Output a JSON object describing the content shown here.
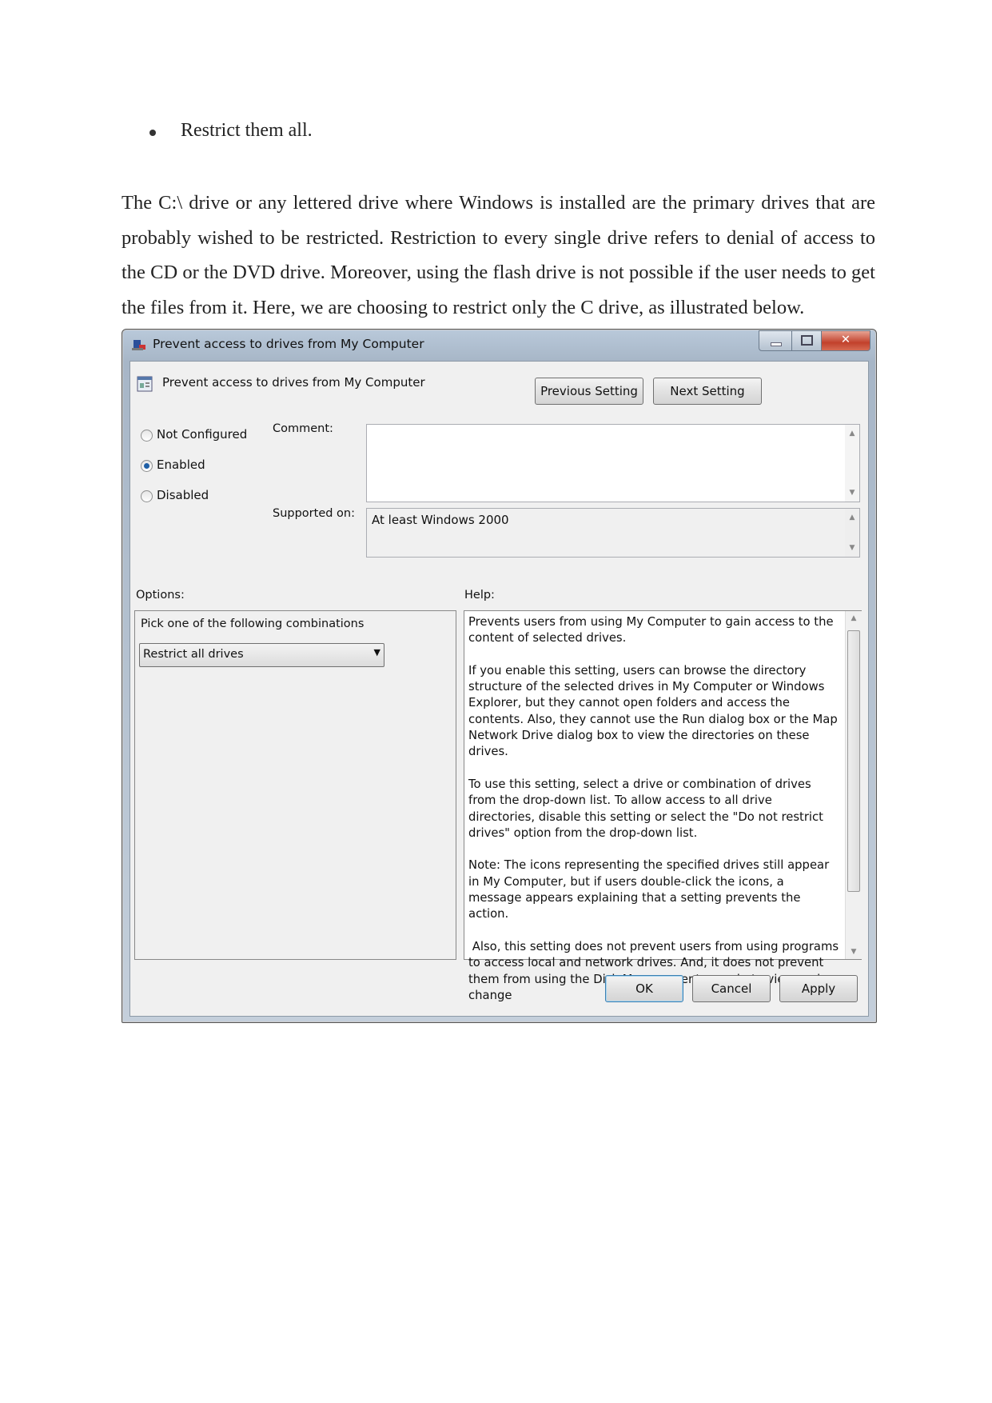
{
  "document": {
    "bullet": "Restrict them all.",
    "paragraph": "The C:\\ drive or any lettered drive where Windows is installed are the primary drives that are probably wished to be restricted. Restriction to every single drive refers to denial of access to the CD or the DVD drive. Moreover, using the flash drive is not possible if the user needs to get the files from it. Here, we are choosing to restrict only the C drive, as illustrated below."
  },
  "dialog": {
    "title": "Prevent access to drives from My Computer",
    "header_title": "Prevent access to drives from My Computer",
    "previous_setting": "Previous Setting",
    "next_setting": "Next Setting",
    "state_options": [
      {
        "label": "Not Configured",
        "selected": false
      },
      {
        "label": "Enabled",
        "selected": true
      },
      {
        "label": "Disabled",
        "selected": false
      }
    ],
    "comment_label": "Comment:",
    "comment_value": "",
    "supported_on_label": "Supported on:",
    "supported_on_value": "At least Windows 2000",
    "options_label": "Options:",
    "help_label": "Help:",
    "options_prompt": "Pick one of the following combinations",
    "drive_select_value": "Restrict all drives",
    "help_text": "Prevents users from using My Computer to gain access to the content of selected drives.\n\nIf you enable this setting, users can browse the directory structure of the selected drives in My Computer or Windows Explorer, but they cannot open folders and access the contents. Also, they cannot use the Run dialog box or the Map Network Drive dialog box to view the directories on these drives.\n\nTo use this setting, select a drive or combination of drives from the drop-down list. To allow access to all drive directories, disable this setting or select the \"Do not restrict drives\" option from the drop-down list.\n\nNote: The icons representing the specified drives still appear in My Computer, but if users double-click the icons, a message appears explaining that a setting prevents the action.\n\n Also, this setting does not prevent users from using programs to access local and network drives. And, it does not prevent them from using the Disk Management snap-in to view and change",
    "ok": "OK",
    "cancel": "Cancel",
    "apply": "Apply"
  }
}
